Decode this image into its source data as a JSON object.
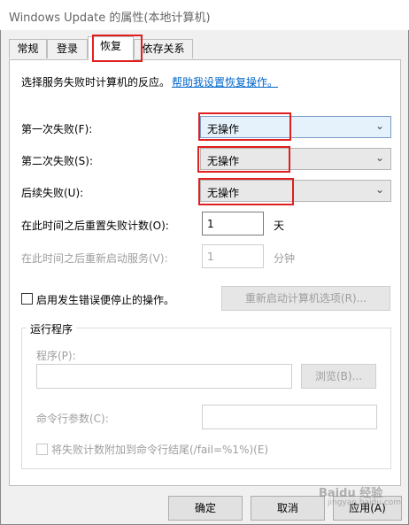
{
  "window": {
    "title": "Windows Update 的属性(本地计算机)"
  },
  "tabs": [
    {
      "label": "常规",
      "active": false
    },
    {
      "label": "登录",
      "active": false
    },
    {
      "label": "恢复",
      "active": true
    },
    {
      "label": "依存关系",
      "active": false
    }
  ],
  "recovery": {
    "intro": "选择服务失败时计算机的反应。",
    "help_link": "帮助我设置恢复操作。",
    "first_failure": {
      "label": "第一次失败(F):",
      "value": "无操作"
    },
    "second_failure": {
      "label": "第二次失败(S):",
      "value": "无操作"
    },
    "subsequent_failure": {
      "label": "后续失败(U):",
      "value": "无操作"
    },
    "reset_count": {
      "label": "在此时间之后重置失败计数(O):",
      "value": "1",
      "unit": "天"
    },
    "restart_service": {
      "label": "在此时间之后重新启动服务(V):",
      "value": "1",
      "unit": "分钟"
    },
    "enable_actions_label": "启用发生错误便停止的操作。",
    "restart_options_button": "重新启动计算机选项(R)...",
    "run_program": {
      "group_title": "运行程序",
      "program_label": "程序(P):",
      "program_value": "",
      "browse_button": "浏览(B)...",
      "cmd_params_label": "命令行参数(C):",
      "cmd_params_value": "",
      "append_fail_label": "将失败计数附加到命令行结尾(/fail=%1%)(E)"
    }
  },
  "footer": {
    "ok": "确定",
    "cancel": "取消",
    "apply": "应用(A)"
  },
  "watermark": {
    "text": "Baidu 经验",
    "sub": "jingyan.baidu.com"
  },
  "colors": {
    "highlight": "#e02020",
    "link": "#0066cc",
    "focus": "#e5f1fb"
  },
  "icons": {
    "dropdown": "chevron-down-icon"
  }
}
